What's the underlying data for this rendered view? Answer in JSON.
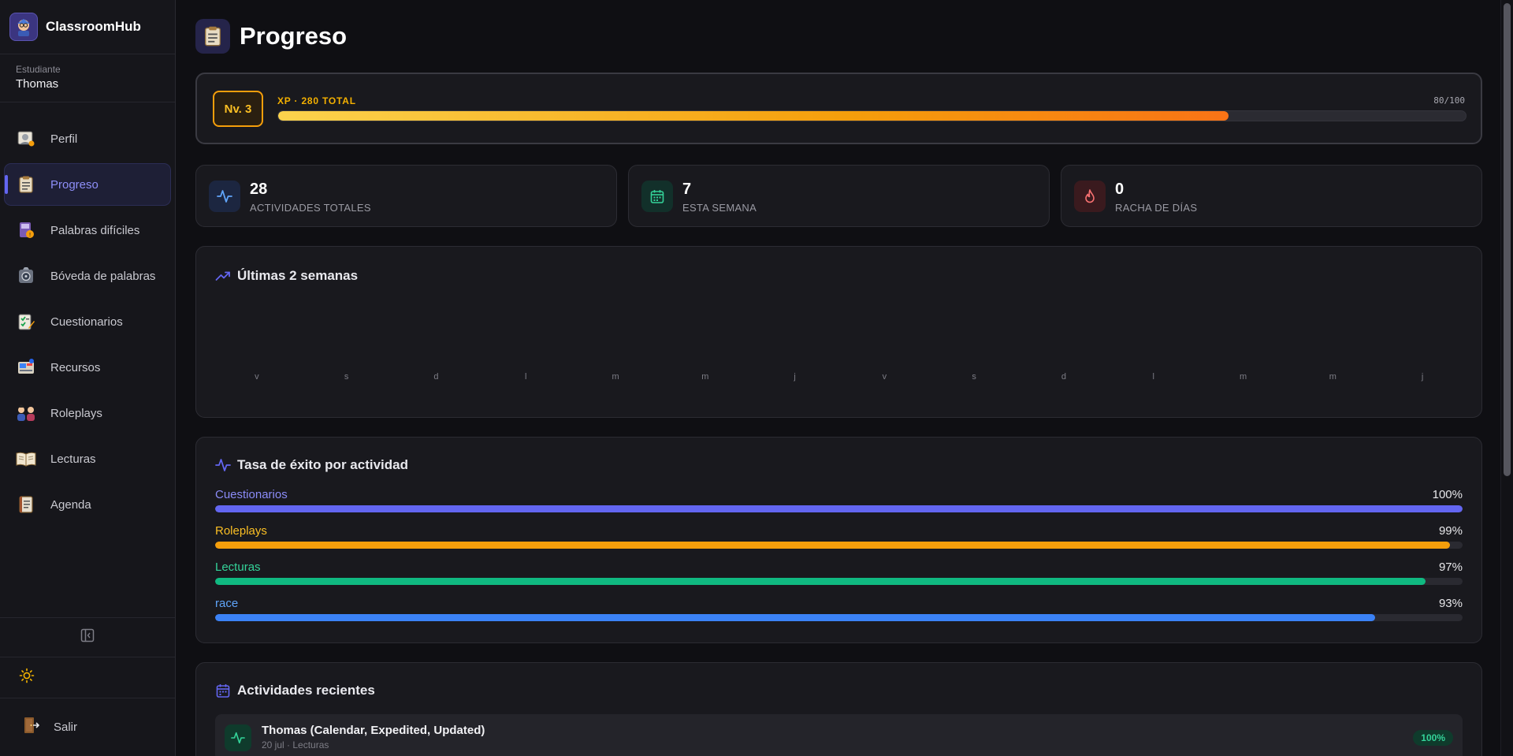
{
  "app": {
    "name": "ClassroomHub"
  },
  "user": {
    "role": "Estudiante",
    "name": "Thomas"
  },
  "nav": [
    {
      "label": "Perfil",
      "icon": "profile-icon",
      "active": false
    },
    {
      "label": "Progreso",
      "icon": "clipboard-icon",
      "active": true
    },
    {
      "label": "Palabras difíciles",
      "icon": "hard-words-icon",
      "active": false
    },
    {
      "label": "Bóveda de palabras",
      "icon": "vault-icon",
      "active": false
    },
    {
      "label": "Cuestionarios",
      "icon": "quiz-icon",
      "active": false
    },
    {
      "label": "Recursos",
      "icon": "resources-icon",
      "active": false
    },
    {
      "label": "Roleplays",
      "icon": "roleplay-icon",
      "active": false
    },
    {
      "label": "Lecturas",
      "icon": "book-icon",
      "active": false
    },
    {
      "label": "Agenda",
      "icon": "agenda-icon",
      "active": false
    }
  ],
  "sidebar_bottom": {
    "logout_label": "Salir"
  },
  "page": {
    "title": "Progreso"
  },
  "xp": {
    "level_label": "Nv. 3",
    "label": "XP · 280 TOTAL",
    "count": "80/100",
    "progress": 0.8
  },
  "stats": [
    {
      "value": "28",
      "label": "ACTIVIDADES TOTALES",
      "icon": "activity-icon",
      "color": "#60a5fa",
      "bg": "#1c2640"
    },
    {
      "value": "7",
      "label": "ESTA SEMANA",
      "icon": "calendar-icon",
      "color": "#34d399",
      "bg": "#12302a"
    },
    {
      "value": "0",
      "label": "RACHA DE DÍAS",
      "icon": "flame-icon",
      "color": "#f87171",
      "bg": "#3a1a1e"
    }
  ],
  "weekly": {
    "title": "Últimas 2 semanas",
    "chart_data": {
      "type": "bar",
      "categories": [
        "v",
        "s",
        "d",
        "l",
        "m",
        "m",
        "j",
        "v",
        "s",
        "d",
        "l",
        "m",
        "m",
        "j"
      ],
      "values": [
        0,
        0,
        0,
        0,
        0,
        0,
        0,
        0,
        0,
        0,
        0,
        0,
        0,
        0
      ],
      "title": "Últimas 2 semanas"
    }
  },
  "success": {
    "title": "Tasa de éxito por actividad",
    "items": [
      {
        "name": "Cuestionarios",
        "pct": "100%",
        "value": 1.0,
        "color": "#6366f1",
        "text_color": "#8b8cf8"
      },
      {
        "name": "Roleplays",
        "pct": "99%",
        "value": 0.99,
        "color": "#f59e0b",
        "text_color": "#fbbf24"
      },
      {
        "name": "Lecturas",
        "pct": "97%",
        "value": 0.97,
        "color": "#10b981",
        "text_color": "#34d399"
      },
      {
        "name": "race",
        "pct": "93%",
        "value": 0.93,
        "color": "#3b82f6",
        "text_color": "#60a5fa"
      }
    ]
  },
  "recent": {
    "title": "Actividades recientes",
    "items": [
      {
        "title": "Thomas (Calendar, Expedited, Updated)",
        "meta": "20 jul · Lecturas",
        "badge": "100%"
      }
    ]
  }
}
